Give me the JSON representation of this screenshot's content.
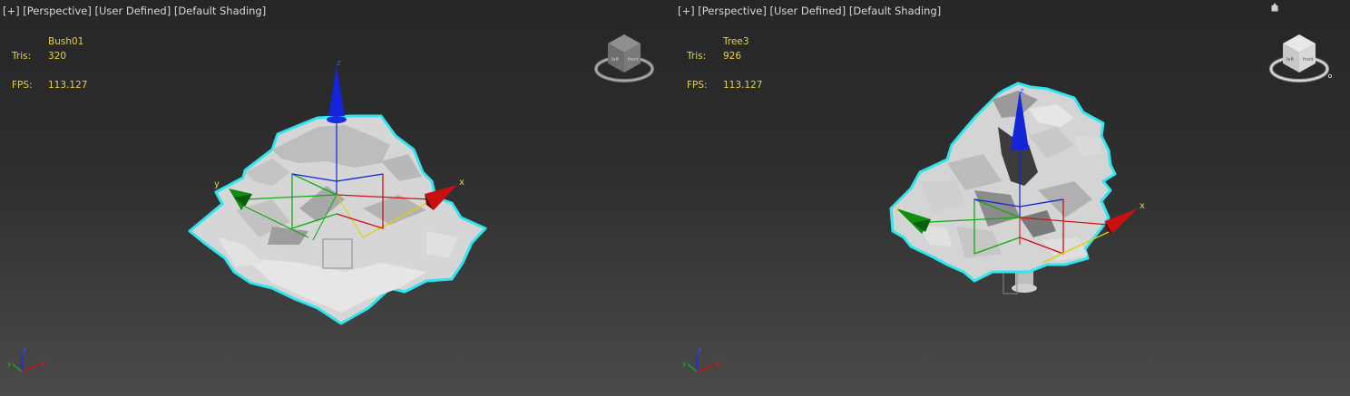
{
  "viewports": [
    {
      "label": {
        "plus": "[+]",
        "view": "[Perspective]",
        "lighting": "[User Defined]",
        "shading": "[Default Shading]"
      },
      "stats": {
        "object_name": "Bush01",
        "tris_label": "Tris:",
        "tris_value": "320",
        "fps_label": "FPS:",
        "fps_value": "113.127"
      }
    },
    {
      "label": {
        "plus": "[+]",
        "view": "[Perspective]",
        "lighting": "[User Defined]",
        "shading": "[Default Shading]"
      },
      "stats": {
        "object_name": "Tree3",
        "tris_label": "Tris:",
        "tris_value": "926",
        "fps_label": "FPS:",
        "fps_value": "113.127"
      }
    }
  ],
  "gizmo": {
    "x_label": "x",
    "y_label": "y",
    "z_label": "z"
  },
  "viewcube": {
    "front_label": "front",
    "left_label": "left"
  },
  "colors": {
    "selection_outline": "#2fe6f0",
    "axis_x": "#cc1111",
    "axis_y": "#11aa11",
    "axis_z": "#1122dd",
    "stats_text": "#e8d04a",
    "mesh": "#d9d9d9"
  },
  "icons": [
    "viewcube-icon",
    "axis-tripod-icon",
    "move-gizmo-icon",
    "maximize-icon"
  ]
}
